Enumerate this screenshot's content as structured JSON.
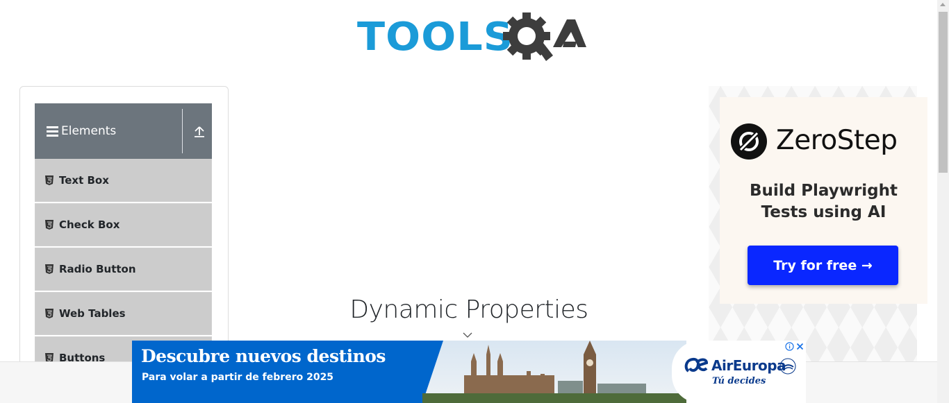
{
  "header": {
    "logo_text": "TOOLSQA"
  },
  "sidebar": {
    "group_title": "Elements",
    "items": [
      {
        "label": "Text Box"
      },
      {
        "label": "Check Box"
      },
      {
        "label": "Radio Button"
      },
      {
        "label": "Web Tables"
      },
      {
        "label": "Buttons"
      }
    ]
  },
  "main": {
    "title": "Dynamic Properties"
  },
  "side_ad": {
    "brand": "ZeroStep",
    "tagline_line1": "Build Playwright",
    "tagline_line2": "Tests using AI",
    "cta": "Try for free →",
    "cta_color": "#0a27ff"
  },
  "bottom_ad": {
    "headline": "Descubre nuevos destinos",
    "subline": "Para volar a partir de febrero 2025",
    "brand": "AirEuropa",
    "brand_tagline": "Tú decides",
    "brand_color": "#0066cc"
  },
  "icons": {
    "menu": "hamburger-icon",
    "collapse": "upload-arrow-icon",
    "item": "html5-icon",
    "ad_info": "info-icon",
    "ad_close": "close-icon"
  }
}
